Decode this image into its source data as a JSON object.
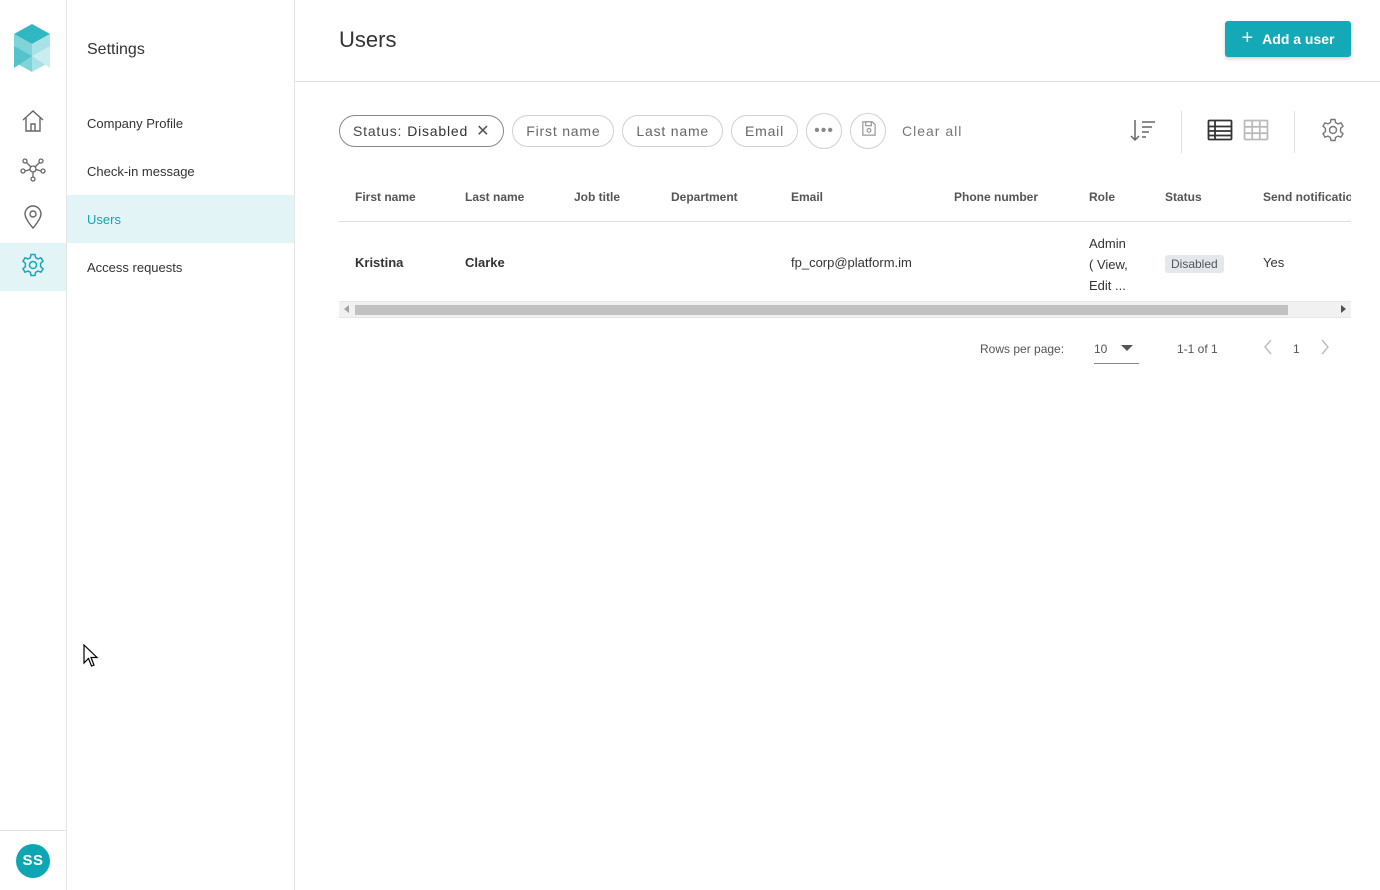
{
  "app": {
    "brand_colors": {
      "accent": "#13a9b7",
      "active_bg": "#e3f4f6"
    }
  },
  "rail": {
    "items": [
      {
        "name": "home",
        "icon": "home-icon"
      },
      {
        "name": "network",
        "icon": "network-icon"
      },
      {
        "name": "location",
        "icon": "location-pin-icon"
      },
      {
        "name": "settings",
        "icon": "gear-icon",
        "active": true
      }
    ],
    "avatar_initials": "SS"
  },
  "subnav": {
    "title": "Settings",
    "items": [
      {
        "label": "Company Profile"
      },
      {
        "label": "Check-in message"
      },
      {
        "label": "Users",
        "active": true
      },
      {
        "label": "Access requests"
      }
    ]
  },
  "header": {
    "title": "Users",
    "add_button_label": "Add a user"
  },
  "filters": {
    "active_filter_key": "Status:",
    "active_filter_value": "Disabled",
    "chips": [
      "First name",
      "Last name",
      "Email"
    ],
    "clear_all": "Clear all"
  },
  "table": {
    "columns": [
      "First name",
      "Last name",
      "Job title",
      "Department",
      "Email",
      "Phone number",
      "Role",
      "Status",
      "Send notificatio"
    ],
    "rows": [
      {
        "first_name": "Kristina",
        "last_name": "Clarke",
        "job_title": "",
        "department": "",
        "email": "fp_corp@platform.im",
        "phone": "",
        "role": "Admin\n( View,\nEdit ...",
        "status": "Disabled",
        "send_notification": "Yes"
      }
    ]
  },
  "pagination": {
    "rows_per_page_label": "Rows per page:",
    "rows_per_page_value": "10",
    "range": "1-1 of 1",
    "page": "1"
  }
}
